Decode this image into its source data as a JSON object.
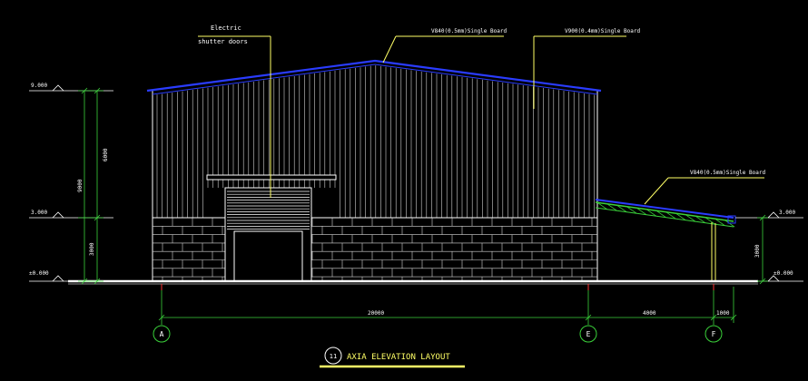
{
  "title": {
    "circle_number": "11",
    "text": "AXIA ELEVATION LAYOUT"
  },
  "annotations": {
    "door_line1": "Electric",
    "door_line2": "shutter doors",
    "roof_main": "V840(0.5mm)Single  Board",
    "wall_main": "V900(0.4mm)Single Board",
    "roof_canopy": "V840(0.5mm)Single  Board"
  },
  "levels": {
    "left_top": "9.000",
    "left_mid": "3.000",
    "left_ground": "±0.000",
    "right_mid": "3.000",
    "right_ground": "±0.000"
  },
  "dimensions": {
    "left_upper": "6000",
    "left_total": "9000",
    "left_lower": "3000",
    "right_height": "3000",
    "span_A_E": "20000",
    "span_E_F": "4000",
    "span_F_end": "1000"
  },
  "axes": [
    "A",
    "E",
    "F"
  ],
  "colors": {
    "background": "#000000",
    "wall_lines": "#ffffff",
    "roof": "#2a3cff",
    "canopy": "#3ad13a",
    "dimension": "#3ad13a",
    "leader": "#ffff66",
    "title_underline": "#ffff66"
  }
}
